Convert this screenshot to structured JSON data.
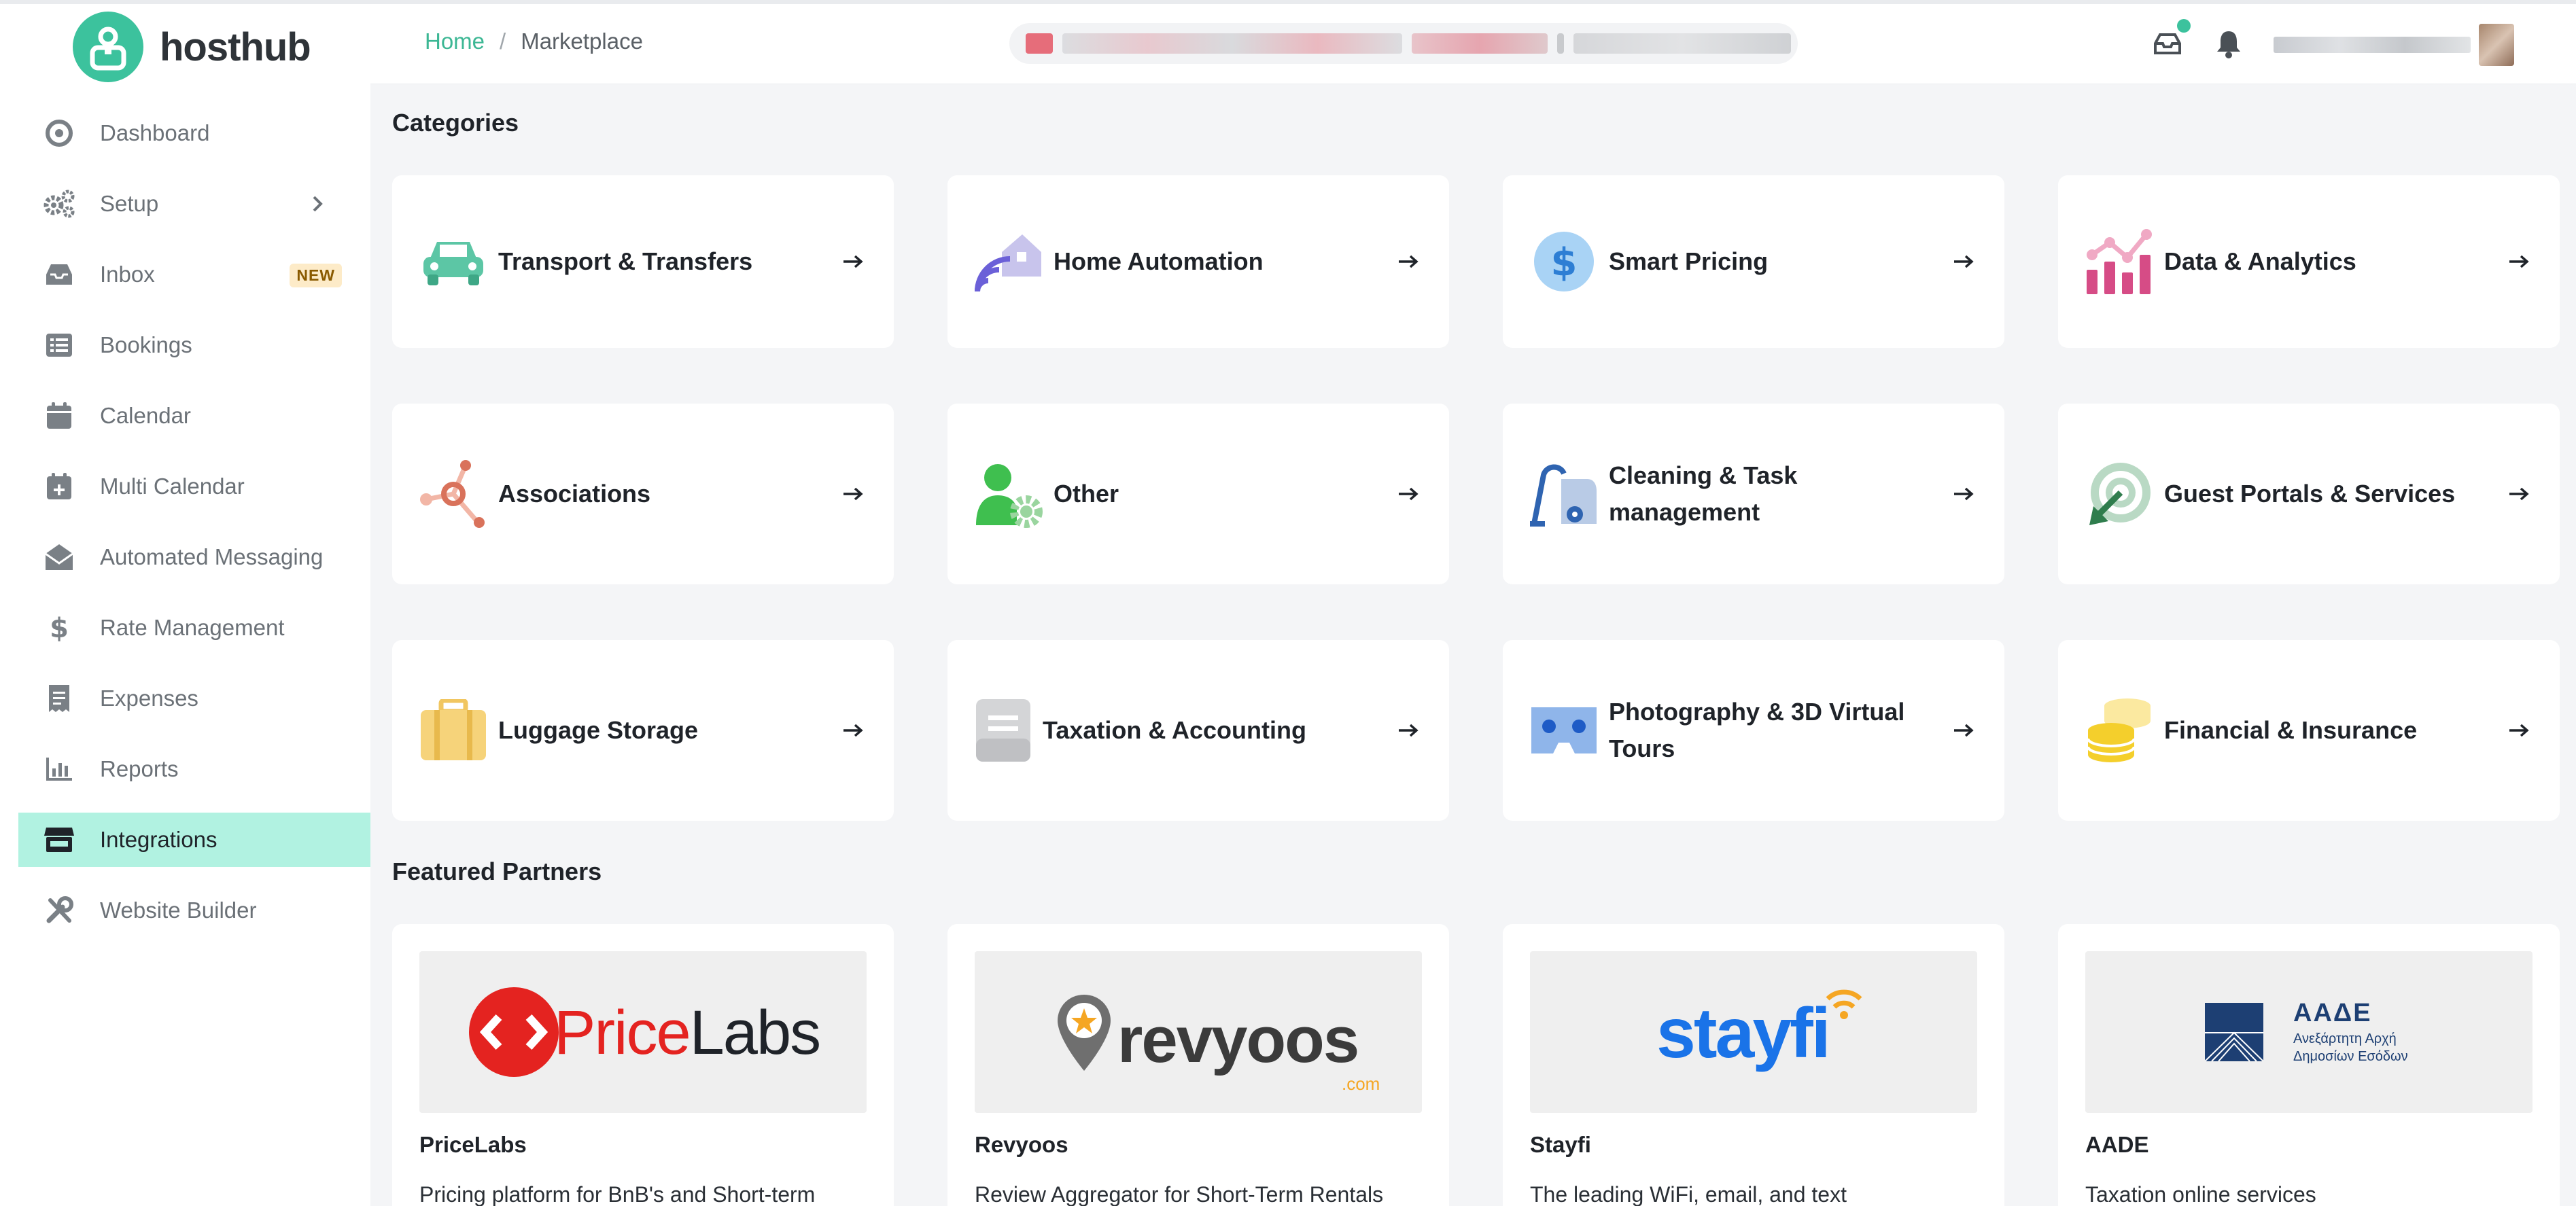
{
  "app": {
    "name": "hosthub"
  },
  "sidebar": {
    "items": [
      {
        "label": "Dashboard",
        "icon": "dashboard-icon"
      },
      {
        "label": "Setup",
        "icon": "gears-icon",
        "has_submenu": true
      },
      {
        "label": "Inbox",
        "icon": "inbox-icon",
        "badge": "NEW"
      },
      {
        "label": "Bookings",
        "icon": "list-icon"
      },
      {
        "label": "Calendar",
        "icon": "calendar-icon"
      },
      {
        "label": "Multi Calendar",
        "icon": "calendar-plus-icon"
      },
      {
        "label": "Automated Messaging",
        "icon": "envelope-open-icon"
      },
      {
        "label": "Rate Management",
        "icon": "dollar-icon"
      },
      {
        "label": "Expenses",
        "icon": "receipt-icon"
      },
      {
        "label": "Reports",
        "icon": "bar-chart-icon"
      },
      {
        "label": "Integrations",
        "icon": "store-icon",
        "active": true
      },
      {
        "label": "Website Builder",
        "icon": "tools-icon"
      }
    ]
  },
  "header": {
    "breadcrumb": {
      "home": "Home",
      "separator": "/",
      "current": "Marketplace"
    },
    "notifications_icon": "bell-icon",
    "inbox_icon": "inbox-icon"
  },
  "main": {
    "categories_title": "Categories",
    "categories": [
      {
        "label": "Transport & Transfers",
        "icon": "car-icon"
      },
      {
        "label": "Home Automation",
        "icon": "smart-home-icon"
      },
      {
        "label": "Smart Pricing",
        "icon": "dollar-circle-icon"
      },
      {
        "label": "Data & Analytics",
        "icon": "analytics-icon"
      },
      {
        "label": "Associations",
        "icon": "network-icon"
      },
      {
        "label": "Other",
        "icon": "user-gear-icon"
      },
      {
        "label": "Cleaning & Task management",
        "icon": "vacuum-icon"
      },
      {
        "label": "Guest Portals & Services",
        "icon": "target-arrow-icon"
      },
      {
        "label": "Luggage Storage",
        "icon": "suitcase-icon"
      },
      {
        "label": "Taxation & Accounting",
        "icon": "document-icon"
      },
      {
        "label": "Photography & 3D Virtual Tours",
        "icon": "vr-headset-icon"
      },
      {
        "label": "Financial & Insurance",
        "icon": "coins-icon"
      }
    ],
    "partners_title": "Featured Partners",
    "partners": [
      {
        "name": "PriceLabs",
        "description": "Pricing platform for BnB's and Short-term",
        "logo_text": "PriceLabs"
      },
      {
        "name": "Revyoos",
        "description": "Review Aggregator for Short-Term Rentals",
        "logo_text": "revyoos",
        "logo_sub": ".com"
      },
      {
        "name": "Stayfi",
        "description": "The leading WiFi, email, and text",
        "logo_text": "stayfi"
      },
      {
        "name": "AADE",
        "description": "Taxation online services",
        "logo_text": "ΑΑΔΕ",
        "logo_sub1": "Ανεξάρτητη Αρχή",
        "logo_sub2": "Δημοσίων Εσόδων"
      }
    ]
  },
  "colors": {
    "brand": "#3cc29d",
    "active_nav": "#b1f2e1",
    "breadcrumb_link": "#3cb794",
    "pricelabs_red": "#e42320",
    "revyoos_orange": "#f5a623",
    "stayfi_blue": "#1a73e8",
    "aade_navy": "#1d3f73"
  }
}
